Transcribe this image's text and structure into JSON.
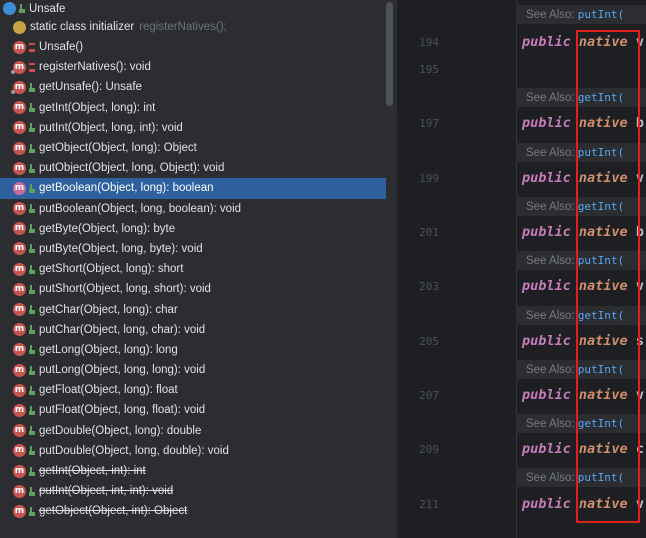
{
  "structure": {
    "root_label": "Unsafe",
    "static_init_label": "static class initializer",
    "static_init_hint": "registerNatives();",
    "method_badge": "m",
    "members": [
      {
        "label": "Unsafe()",
        "vis": "priv"
      },
      {
        "label": "registerNatives(): void",
        "vis": "priv"
      },
      {
        "label": "getUnsafe(): Unsafe",
        "vis": "pub"
      },
      {
        "label": "getInt(Object, long): int",
        "vis": "pub"
      },
      {
        "label": "putInt(Object, long, int): void",
        "vis": "pub"
      },
      {
        "label": "getObject(Object, long): Object",
        "vis": "pub"
      },
      {
        "label": "putObject(Object, long, Object): void",
        "vis": "pub"
      },
      {
        "label": "getBoolean(Object, long): boolean",
        "vis": "pub"
      },
      {
        "label": "putBoolean(Object, long, boolean): void",
        "vis": "pub"
      },
      {
        "label": "getByte(Object, long): byte",
        "vis": "pub"
      },
      {
        "label": "putByte(Object, long, byte): void",
        "vis": "pub"
      },
      {
        "label": "getShort(Object, long): short",
        "vis": "pub"
      },
      {
        "label": "putShort(Object, long, short): void",
        "vis": "pub"
      },
      {
        "label": "getChar(Object, long): char",
        "vis": "pub"
      },
      {
        "label": "putChar(Object, long, char): void",
        "vis": "pub"
      },
      {
        "label": "getLong(Object, long): long",
        "vis": "pub"
      },
      {
        "label": "putLong(Object, long, long): void",
        "vis": "pub"
      },
      {
        "label": "getFloat(Object, long): float",
        "vis": "pub"
      },
      {
        "label": "putFloat(Object, long, float): void",
        "vis": "pub"
      },
      {
        "label": "getDouble(Object, long): double",
        "vis": "pub"
      },
      {
        "label": "putDouble(Object, long, double): void",
        "vis": "pub"
      },
      {
        "label": "getInt(Object, int): int",
        "vis": "pub"
      },
      {
        "label": "putInt(Object, int, int): void",
        "vis": "pub"
      },
      {
        "label": "getObject(Object, int): Object",
        "vis": "pub"
      }
    ]
  },
  "editor": {
    "top_hint": {
      "text": "See Also:",
      "ref": "putInt("
    },
    "lines": [
      {
        "num": "194",
        "public": "public",
        "native": "native",
        "tail": "v"
      },
      {
        "num": "195"
      },
      {
        "hint_text": "See Also:",
        "hint_ref": "getInt("
      },
      {
        "num": "197",
        "public": "public",
        "native": "native",
        "tail": "b"
      },
      {
        "hint_text": "See Also:",
        "hint_ref": "putInt("
      },
      {
        "num": "199",
        "public": "public",
        "native": "native",
        "tail": "v"
      },
      {
        "hint_text": "See Also:",
        "hint_ref": "getInt("
      },
      {
        "num": "201",
        "public": "public",
        "native": "native",
        "tail": "b"
      },
      {
        "hint_text": "See Also:",
        "hint_ref": "putInt("
      },
      {
        "num": "203",
        "public": "public",
        "native": "native",
        "tail": "v"
      },
      {
        "hint_text": "See Also:",
        "hint_ref": "getInt("
      },
      {
        "num": "205",
        "public": "public",
        "native": "native",
        "tail": "s"
      },
      {
        "hint_text": "See Also:",
        "hint_ref": "putInt("
      },
      {
        "num": "207",
        "public": "public",
        "native": "native",
        "tail": "v"
      },
      {
        "hint_text": "See Also:",
        "hint_ref": "getInt("
      },
      {
        "num": "209",
        "public": "public",
        "native": "native",
        "tail": "c"
      },
      {
        "hint_text": "See Also:",
        "hint_ref": "putInt("
      },
      {
        "num": "211",
        "public": "public",
        "native": "native",
        "tail": "v"
      }
    ]
  },
  "colors": {
    "selection": "#2e5f9e",
    "highlight_box": "#e0201e",
    "keyword_public": "#c77dbb",
    "keyword_native": "#cf8e6d"
  }
}
